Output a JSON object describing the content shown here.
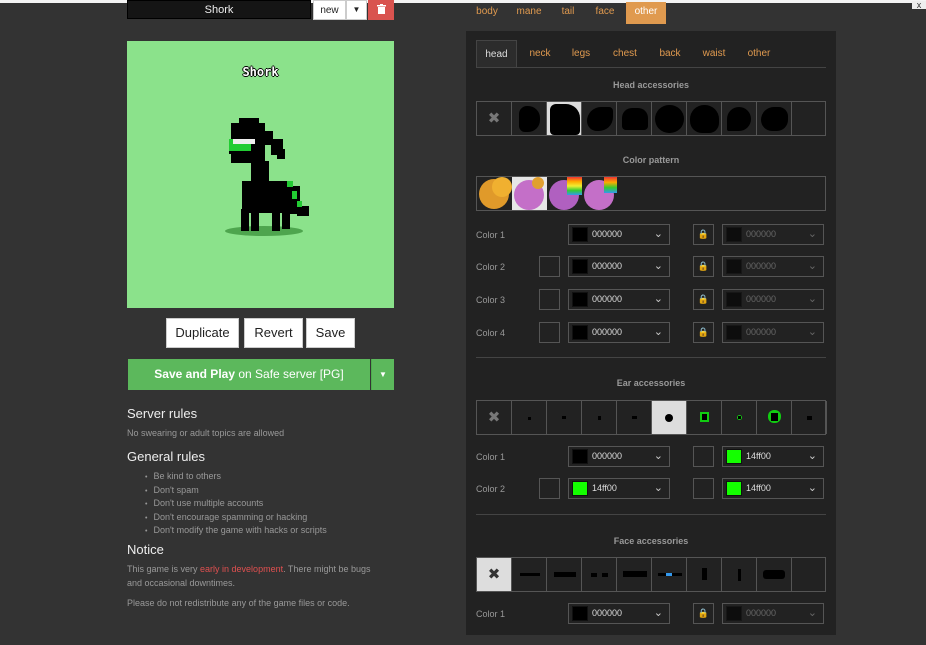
{
  "window": {
    "close_glyph": "x"
  },
  "pony": {
    "name": "Shork",
    "name_label": "Shork"
  },
  "name_bar": {
    "new_label": "new",
    "caret": "▼",
    "delete_icon": "trash-icon"
  },
  "actions": {
    "duplicate": "Duplicate",
    "revert": "Revert",
    "save": "Save"
  },
  "play": {
    "bold": "Save and Play",
    "rest": " on Safe server [PG]",
    "caret": "▼"
  },
  "server_rules": {
    "title": "Server rules",
    "text": "No swearing or adult topics are allowed"
  },
  "general_rules": {
    "title": "General rules",
    "items": [
      "Be kind to others",
      "Don't spam",
      "Don't use multiple accounts",
      "Don't encourage spamming or hacking",
      "Don't modify the game with hacks or scripts"
    ]
  },
  "notice": {
    "title": "Notice",
    "line_pre": "This game is very ",
    "line_link": "early in development",
    "line_post": ". There might be bugs",
    "line2": "and occasional downtimes.",
    "line3": "Please do not redistribute any of the game files or code."
  },
  "top_tabs": [
    "body",
    "mane",
    "tail",
    "face",
    "other"
  ],
  "sub_tabs": [
    "head",
    "neck",
    "legs",
    "chest",
    "back",
    "waist",
    "other"
  ],
  "sections": {
    "head": "Head accessories",
    "pattern": "Color pattern",
    "ear": "Ear accessories",
    "face": "Face accessories"
  },
  "head_colors": [
    {
      "label": "Color 1",
      "value": "000000",
      "right": "000000"
    },
    {
      "label": "Color 2",
      "value": "000000",
      "right": "000000"
    },
    {
      "label": "Color 3",
      "value": "000000",
      "right": "000000"
    },
    {
      "label": "Color 4",
      "value": "000000",
      "right": "000000"
    }
  ],
  "ear_colors": [
    {
      "label": "Color 1",
      "value": "000000",
      "right": "14ff00"
    },
    {
      "label": "Color 2",
      "value": "14ff00",
      "right": "14ff00"
    }
  ],
  "face_colors": [
    {
      "label": "Color 1",
      "value": "000000",
      "right": "000000"
    }
  ],
  "colors": {
    "accent": "#e09a4f",
    "preview_bg": "#8be28b",
    "play_green": "#5cb85c",
    "black": "#000000",
    "green": "#14ff00"
  }
}
